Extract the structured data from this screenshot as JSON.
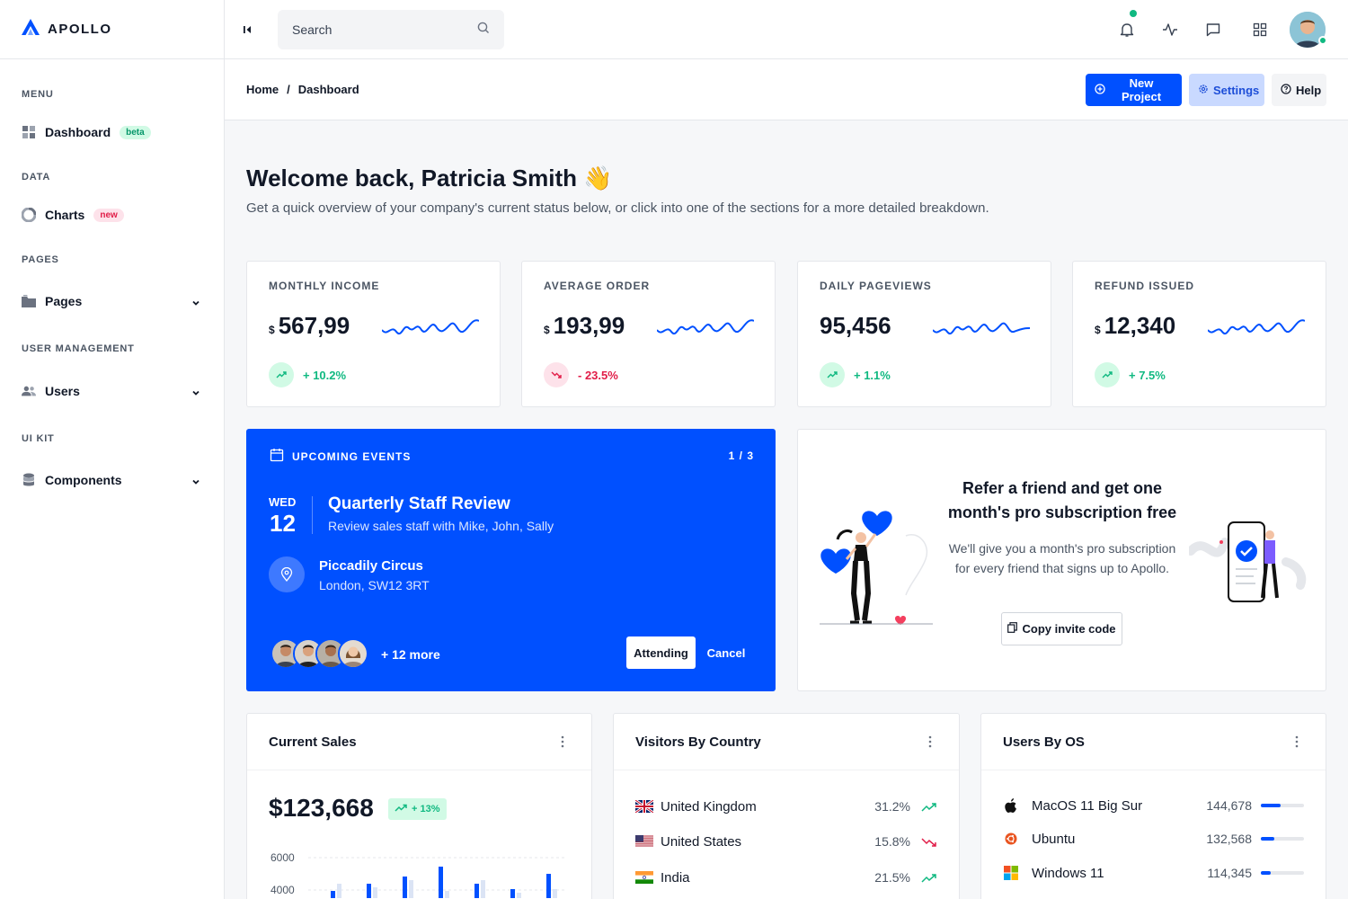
{
  "brand": {
    "name": "APOLLO"
  },
  "sidebar": {
    "sections": [
      {
        "heading": "MENU",
        "item": "Dashboard",
        "badge": "beta"
      },
      {
        "heading": "DATA",
        "item": "Charts",
        "badge": "new"
      },
      {
        "heading": "PAGES",
        "item": "Pages"
      },
      {
        "heading": "USER MANAGEMENT",
        "item": "Users"
      },
      {
        "heading": "UI KIT",
        "item": "Components"
      }
    ]
  },
  "topbar": {
    "search_placeholder": "Search"
  },
  "breadcrumb": {
    "home": "Home",
    "sep": "/",
    "current": "Dashboard"
  },
  "actions": {
    "new_project": "New Project",
    "settings": "Settings",
    "help": "Help"
  },
  "welcome": {
    "title": "Welcome back, Patricia Smith 👋",
    "subtitle": "Get a quick overview of your company's current status below, or click into one of the sections for a more detailed breakdown."
  },
  "stats": [
    {
      "label": "MONTHLY INCOME",
      "currency": "$",
      "value": "567,99",
      "trend": "+ 10.2%",
      "direction": "up"
    },
    {
      "label": "AVERAGE ORDER",
      "currency": "$",
      "value": "193,99",
      "trend": "- 23.5%",
      "direction": "down"
    },
    {
      "label": "DAILY PAGEVIEWS",
      "currency": "",
      "value": "95,456",
      "trend": "+ 1.1%",
      "direction": "up"
    },
    {
      "label": "REFUND ISSUED",
      "currency": "$",
      "value": "12,340",
      "trend": "+ 7.5%",
      "direction": "up"
    }
  ],
  "events": {
    "heading": "UPCOMING EVENTS",
    "count": "1 / 3",
    "day": "WED",
    "date": "12",
    "title": "Quarterly Staff Review",
    "description": "Review sales staff with Mike, John, Sally",
    "place": "Piccadily Circus",
    "address": "London, SW12 3RT",
    "more": "+ 12 more",
    "attending_label": "Attending",
    "cancel_label": "Cancel"
  },
  "refer": {
    "title": "Refer a friend and get one month's pro subscription free",
    "text": "We'll give you a month's pro subscription for every friend that signs up to Apollo.",
    "button": "Copy invite code"
  },
  "current_sales": {
    "title": "Current Sales",
    "value": "$123,668",
    "badge": "+ 13%",
    "y_ticks": [
      "6000",
      "4000"
    ]
  },
  "visitors": {
    "title": "Visitors By Country",
    "rows": [
      {
        "country": "United Kingdom",
        "pct": "31.2%",
        "direction": "up"
      },
      {
        "country": "United States",
        "pct": "15.8%",
        "direction": "down"
      },
      {
        "country": "India",
        "pct": "21.5%",
        "direction": "up"
      }
    ]
  },
  "os": {
    "title": "Users By OS",
    "rows": [
      {
        "name": "MacOS 11 Big Sur",
        "count": "144,678",
        "share": 0.45
      },
      {
        "name": "Ubuntu",
        "count": "132,568",
        "share": 0.32
      },
      {
        "name": "Windows 11",
        "count": "114,345",
        "share": 0.22
      }
    ]
  },
  "colors": {
    "primary": "#0050ff",
    "success": "#10b981",
    "danger": "#e11d48"
  }
}
